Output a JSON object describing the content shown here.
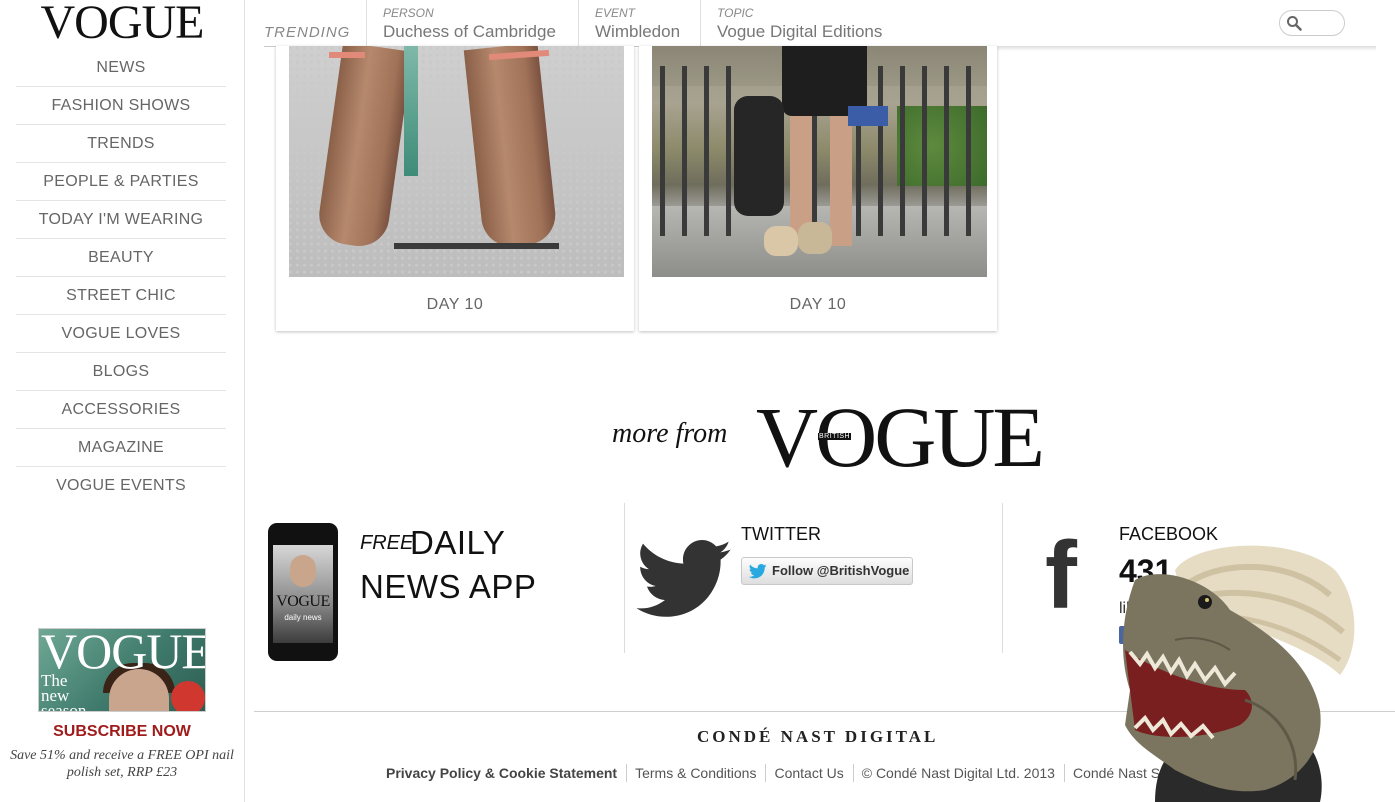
{
  "sidebar": {
    "logo": "VOGUE",
    "nav": [
      "NEWS",
      "FASHION SHOWS",
      "TRENDS",
      "PEOPLE & PARTIES",
      "TODAY I'M WEARING",
      "BEAUTY",
      "STREET CHIC",
      "VOGUE LOVES",
      "BLOGS",
      "ACCESSORIES",
      "MAGAZINE",
      "VOGUE EVENTS"
    ],
    "magazine": {
      "logo": "VOGUE",
      "tagline_1": "The",
      "tagline_2": "new",
      "tagline_3": "season"
    },
    "subscribe_label": "SUBSCRIBE NOW",
    "subscribe_desc": "Save 51% and receive a FREE OPI nail polish set, RRP £23"
  },
  "trending": {
    "label": "TRENDING",
    "items": [
      {
        "kind": "PERSON",
        "value": "Duchess of Cambridge"
      },
      {
        "kind": "EVENT",
        "value": "Wimbledon"
      },
      {
        "kind": "TOPIC",
        "value": "Vogue Digital Editions"
      }
    ]
  },
  "cards": [
    {
      "caption": "DAY 10"
    },
    {
      "caption": "DAY 10"
    }
  ],
  "more_from": {
    "lead": "more from",
    "logo": "VOGUE",
    "edition": "BRITISH"
  },
  "app": {
    "free": "FREE",
    "daily": "DAILY",
    "news_app": "NEWS APP",
    "phone_logo": "VOGUE",
    "phone_sub": "daily news"
  },
  "twitter": {
    "label": "TWITTER",
    "button": "Follow @BritishVogue"
  },
  "facebook": {
    "label": "FACEBOOK",
    "count": "431,",
    "likes": "like"
  },
  "footer": {
    "brand": "CONDÉ NAST DIGITAL",
    "links": [
      "Privacy Policy & Cookie Statement",
      "Terms & Conditions",
      "Contact Us",
      "© Condé Nast Digital Ltd. 2013",
      "Condé Nast Sites"
    ]
  },
  "colors": {
    "subscribe": "#a01c1c",
    "twitter": "#333333",
    "facebook_button": "#4a66a0"
  }
}
